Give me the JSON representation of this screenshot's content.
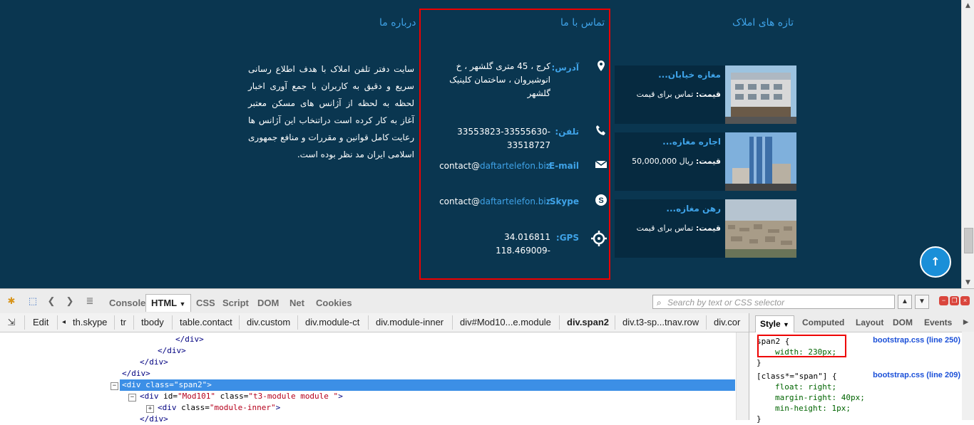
{
  "site": {
    "about": {
      "title": "درباره ما",
      "text": "سایت دفتر تلفن املاک با هدف اطلاع رسانی سریع و دقیق به کاربران با جمع آوری اخبار لحظه به لحظه از آژانس های مسکن معتبر آغاز به کار کرده است  دراتنخاب این آژانس ها رعایت کامل قوانین و مقررات و منافع جمهوری اسلامی ایران مد نظر بوده است."
    },
    "contact": {
      "title": "تماس با ما",
      "address_label": "آدرس:",
      "address_value": "کرج ، 45 متری گلشهر ، خ انوشیروان ، ساختمان کلینیک گلشهر",
      "phone_label": "تلفن:",
      "phone_value": "33553823-33555630-33518727",
      "email_label": "E-mail:",
      "email_user": "contact@",
      "email_domain": "daftartelefon.biz",
      "skype_label": "Skype:",
      "skype_user": "contact@",
      "skype_domain": "daftartelefon.biz",
      "gps_label": "GPS:",
      "gps_lat": "34.016811",
      "gps_lng": "118.469009-"
    },
    "properties": {
      "title": "تازه های املاک",
      "price_label": "قیمت:",
      "items": [
        {
          "title": "مغازه خیابان...",
          "price": "تماس برای قیمت"
        },
        {
          "title": "اجاره مغازه...",
          "price": "ریال 50,000,000"
        },
        {
          "title": "رهن مغازه...",
          "price": "تماس برای قیمت"
        }
      ]
    },
    "back_to_top": "↑"
  },
  "firebug": {
    "tabs": [
      "Console",
      "HTML",
      "CSS",
      "Script",
      "DOM",
      "Net",
      "Cookies"
    ],
    "active_tab": "HTML",
    "search_placeholder": "Search by text or CSS selector",
    "edit_label": "Edit",
    "breadcrumbs": [
      "th.skype",
      "tr",
      "tbody",
      "table.contact",
      "div.custom",
      "div.module-ct",
      "div.module-inner",
      "div#Mod10...e.module",
      "div.span2",
      "div.t3-sp...tnav.row",
      "div.cor"
    ],
    "html_lines": {
      "l1": "</div>",
      "l2": "</div>",
      "l3": "</div>",
      "l4": "</div>",
      "sel_tag": "<div ",
      "sel_attr": "class=",
      "sel_val": "\"span2\"",
      "sel_end": ">",
      "l6_tag": "<div ",
      "l6_attr1": "id=",
      "l6_val1": "\"Mod101\"",
      "l6_attr2": " class=",
      "l6_val2": "\"t3-module module \"",
      "l6_end": ">",
      "l7_tag": "<div ",
      "l7_attr": "class=",
      "l7_val": "\"module-inner\"",
      "l7_end": ">",
      "l8": "</div>"
    },
    "side_tabs": [
      "Style",
      "Computed",
      "Layout",
      "DOM",
      "Events"
    ],
    "css_rules": [
      {
        "selector": "span2 {",
        "source": "bootstrap.css (line 250)",
        "props": [
          "width: 230px;"
        ]
      },
      {
        "selector": "[class*=\"span\"] {",
        "source": "bootstrap.css (line 209)",
        "props": [
          "float: right;",
          "margin-right: 40px;",
          "min-height: 1px;"
        ]
      }
    ]
  }
}
